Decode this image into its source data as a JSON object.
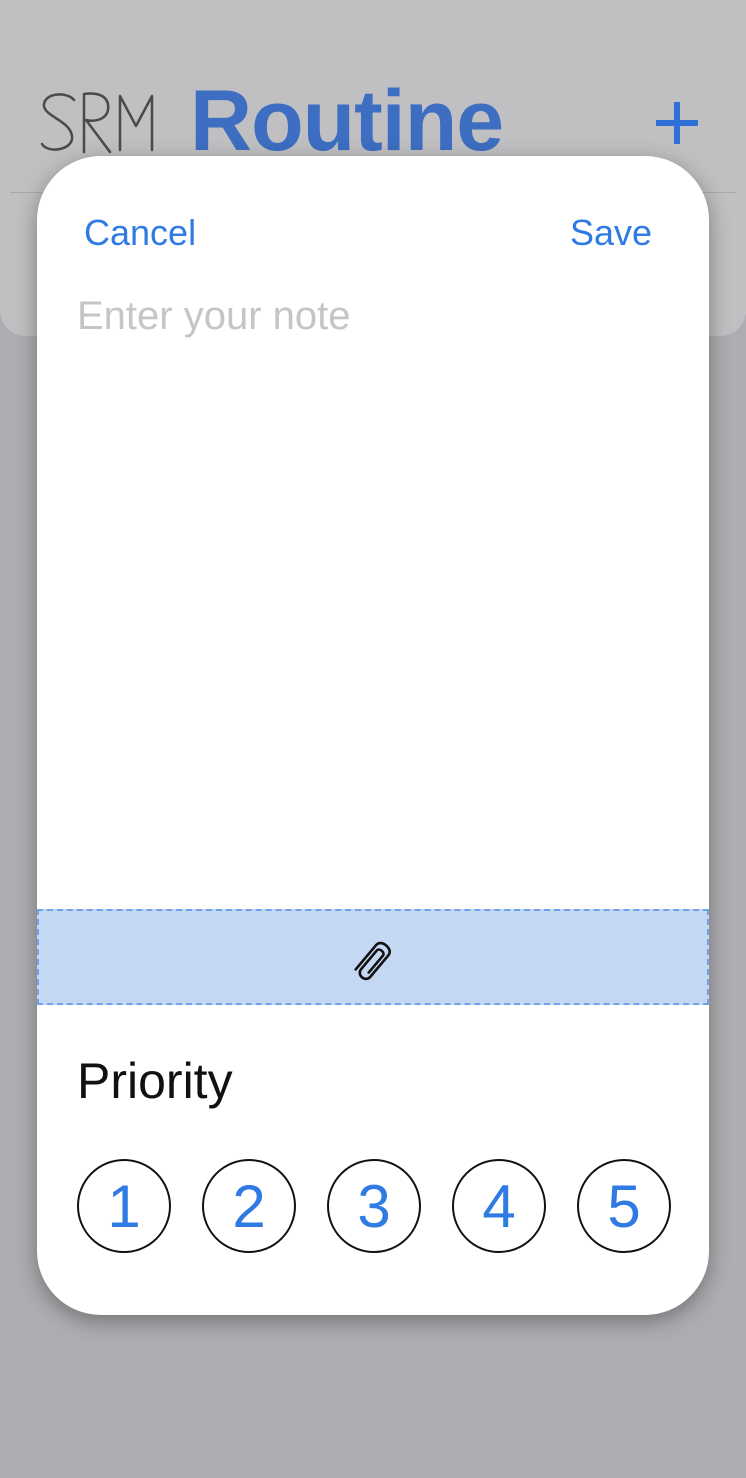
{
  "background": {
    "logo_text": "SRM",
    "title": "Routine",
    "add_icon": "plus-icon"
  },
  "sheet": {
    "cancel_label": "Cancel",
    "save_label": "Save",
    "note_placeholder": "Enter your note",
    "note_value": "",
    "attach_icon": "paperclip-icon",
    "priority": {
      "label": "Priority",
      "options": [
        "1",
        "2",
        "3",
        "4",
        "5"
      ]
    }
  },
  "colors": {
    "accent": "#2f7be3",
    "title": "#3d6ec2",
    "attach_zone": "#c4d7f3",
    "placeholder": "#c5c5c9"
  }
}
